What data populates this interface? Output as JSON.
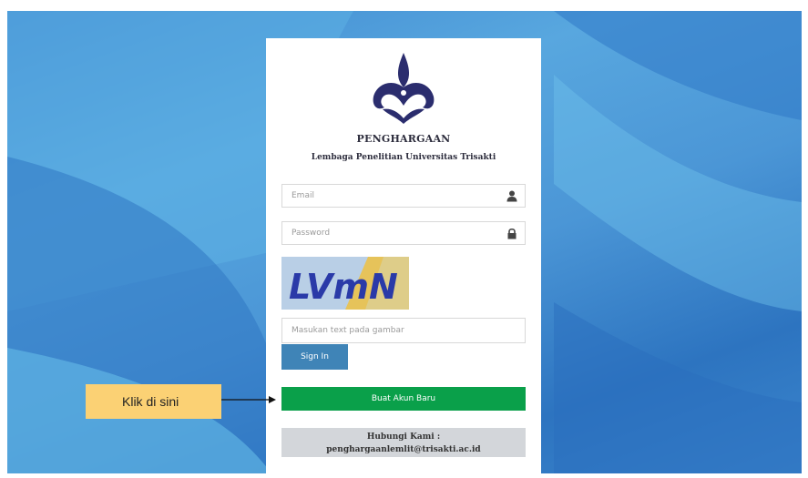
{
  "brand": {
    "title": "PENGHARGAAN",
    "subtitle": "Lembaga Penelitian Universitas Trisakti"
  },
  "form": {
    "email_placeholder": "Email",
    "email_icon": "user-icon",
    "password_placeholder": "Password",
    "password_icon": "lock-icon",
    "captcha_text": "LVmN",
    "captcha_input_placeholder": "Masukan text pada gambar",
    "sign_in_label": "Sign In",
    "create_account_label": "Buat Akun Baru"
  },
  "contact": {
    "title": "Hubungi Kami :",
    "email": "penghargaanlemlit@trisakti.ac.id"
  },
  "annotation": {
    "label": "Klik di sini"
  },
  "colors": {
    "sign_in": "#3f84b7",
    "create_account": "#0aa04a",
    "contact_bg": "#d3d6da",
    "callout": "#fbd174",
    "logo": "#2b2d6e"
  }
}
